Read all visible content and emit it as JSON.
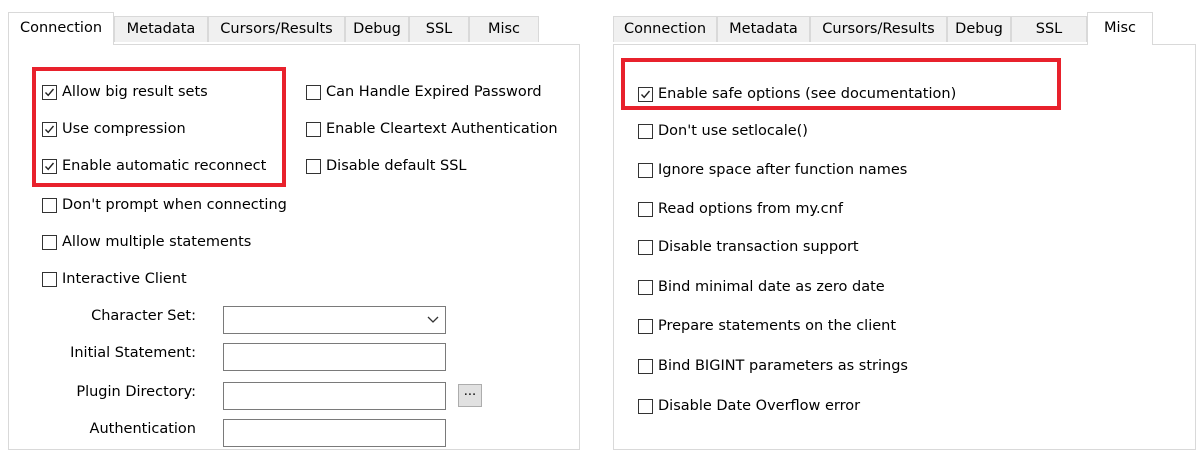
{
  "left": {
    "tabs": [
      "Connection",
      "Metadata",
      "Cursors/Results",
      "Debug",
      "SSL",
      "Misc"
    ],
    "active_tab": "Connection",
    "checkboxes": [
      {
        "label": "Allow big result sets",
        "checked": true
      },
      {
        "label": "Use compression",
        "checked": true
      },
      {
        "label": "Enable automatic reconnect",
        "checked": true
      },
      {
        "label": "Don't prompt when connecting",
        "checked": false
      },
      {
        "label": "Allow multiple statements",
        "checked": false
      },
      {
        "label": "Interactive Client",
        "checked": false
      },
      {
        "label": "Can Handle Expired Password",
        "checked": false
      },
      {
        "label": "Enable Cleartext Authentication",
        "checked": false
      },
      {
        "label": "Disable default SSL",
        "checked": false
      }
    ],
    "fields": {
      "character_set": {
        "label": "Character Set:",
        "value": ""
      },
      "initial_statement": {
        "label": "Initial Statement:",
        "value": ""
      },
      "plugin_directory": {
        "label": "Plugin Directory:",
        "value": "",
        "browse_label": "..."
      },
      "authentication": {
        "label": "Authentication",
        "value": ""
      }
    }
  },
  "right": {
    "tabs": [
      "Connection",
      "Metadata",
      "Cursors/Results",
      "Debug",
      "SSL",
      "Misc"
    ],
    "active_tab": "Misc",
    "checkboxes": [
      {
        "label": "Enable safe options (see documentation)",
        "checked": true
      },
      {
        "label": "Don't use setlocale()",
        "checked": false
      },
      {
        "label": "Ignore space after function names",
        "checked": false
      },
      {
        "label": "Read options from my.cnf",
        "checked": false
      },
      {
        "label": "Disable transaction support",
        "checked": false
      },
      {
        "label": "Bind minimal date as zero date",
        "checked": false
      },
      {
        "label": "Prepare statements on the client",
        "checked": false
      },
      {
        "label": "Bind BIGINT parameters as strings",
        "checked": false
      },
      {
        "label": "Disable Date Overflow error",
        "checked": false
      }
    ]
  },
  "colors": {
    "highlight": "#e8212c",
    "tab_inactive": "#f0f0f0",
    "border": "#d9d9d9"
  },
  "icons": {
    "checkmark": "checkmark-icon",
    "dropdown": "chevron-down-icon"
  }
}
